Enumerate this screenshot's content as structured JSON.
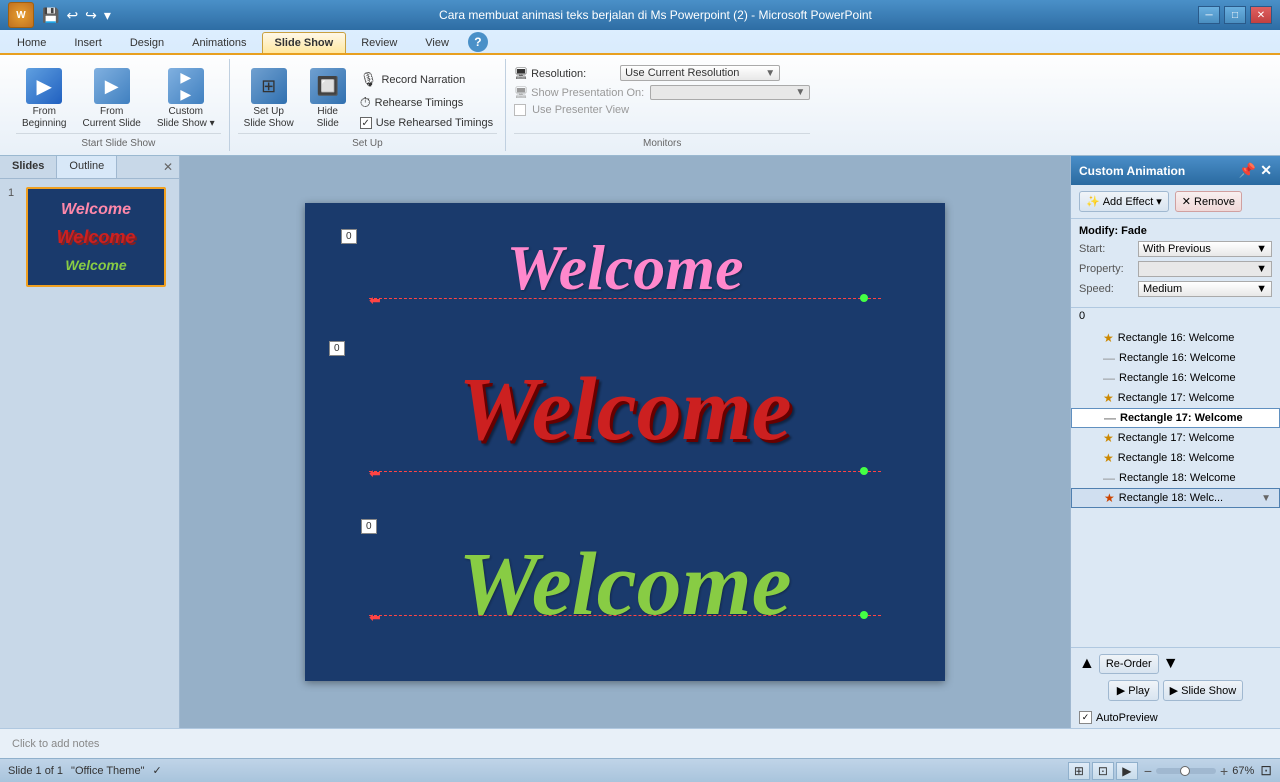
{
  "titleBar": {
    "title": "Cara membuat animasi teks berjalan di Ms Powerpoint (2) - Microsoft PowerPoint",
    "buttons": [
      "minimize",
      "maximize",
      "close"
    ]
  },
  "ribbon": {
    "tabs": [
      "Home",
      "Insert",
      "Design",
      "Animations",
      "Slide Show",
      "Review",
      "View"
    ],
    "activeTab": "Slide Show",
    "groups": {
      "startSlideShow": {
        "label": "Start Slide Show",
        "buttons": [
          {
            "id": "from-beginning",
            "label": "From\nBeginning",
            "icon": "▶"
          },
          {
            "id": "from-current",
            "label": "From\nCurrent Slide",
            "icon": "▶"
          },
          {
            "id": "custom-slide-show",
            "label": "Custom\nSlide Show",
            "icon": "▶"
          },
          {
            "id": "slide-show-label",
            "label": "Slide Show",
            "icon": ""
          }
        ]
      },
      "setUp": {
        "label": "Set Up",
        "buttons": [
          {
            "id": "set-up-slide-show",
            "label": "Set Up\nSlide Show",
            "icon": "⚙"
          },
          {
            "id": "hide-slide",
            "label": "Hide\nSlide",
            "icon": "🔲"
          }
        ],
        "smallButtons": [
          {
            "id": "record-narration",
            "label": "Record Narration",
            "icon": "🎙"
          },
          {
            "id": "rehearse-timings",
            "label": "Rehearse Timings",
            "icon": "⏱"
          },
          {
            "id": "use-rehearsed-timings",
            "label": "Use Rehearsed Timings",
            "icon": "✓",
            "checkbox": true
          }
        ]
      },
      "monitors": {
        "label": "Monitors",
        "rows": [
          {
            "label": "Resolution:",
            "value": "Use Current Resolution",
            "icon": "▼"
          },
          {
            "label": "Show Presentation On:",
            "value": "",
            "icon": "▼"
          },
          {
            "label": "Use Presenter View",
            "checkbox": true
          }
        ]
      }
    }
  },
  "slidesPanel": {
    "tabs": [
      "Slides",
      "Outline"
    ],
    "activeTab": "Slides",
    "slides": [
      {
        "number": 1,
        "texts": [
          {
            "text": "Welcome",
            "color": "pink"
          },
          {
            "text": "Welcome",
            "color": "red"
          },
          {
            "text": "Welcome",
            "color": "green"
          }
        ]
      }
    ]
  },
  "canvas": {
    "badge1": "0",
    "badge2": "0",
    "badge3": "0",
    "welcome1": "Welcome",
    "welcome2": "Welcome",
    "welcome3": "Welcome"
  },
  "animationPanel": {
    "title": "Custom Animation",
    "toolbar": {
      "addEffect": "Add Effect",
      "remove": "Remove"
    },
    "modify": {
      "title": "Modify: Fade",
      "start": {
        "label": "Start:",
        "value": "With Previous",
        "icon": "▼"
      },
      "property": {
        "label": "Property:",
        "value": "",
        "icon": "▼"
      },
      "speed": {
        "label": "Speed:",
        "value": "Medium",
        "icon": "▼"
      }
    },
    "listBadge": "0",
    "items": [
      {
        "id": "r16-1",
        "icon": "star",
        "text": "Rectangle 16: Welcome",
        "selected": false,
        "badge": true
      },
      {
        "id": "r16-2",
        "icon": "line",
        "text": "Rectangle 16: Welcome",
        "selected": false
      },
      {
        "id": "r16-3",
        "icon": "line",
        "text": "Rectangle 16: Welcome",
        "selected": false
      },
      {
        "id": "r17-1",
        "icon": "star",
        "text": "Rectangle 17: Welcome",
        "selected": false
      },
      {
        "id": "r17-2",
        "icon": "line",
        "text": "Rectangle 17: Welcome",
        "selected": true
      },
      {
        "id": "r17-3",
        "icon": "star",
        "text": "Rectangle 17: Welcome",
        "selected": false
      },
      {
        "id": "r18-1",
        "icon": "star",
        "text": "Rectangle 18: Welcome",
        "selected": false
      },
      {
        "id": "r18-2",
        "icon": "line",
        "text": "Rectangle 18: Welcome",
        "selected": false
      },
      {
        "id": "r18-3",
        "icon": "star",
        "text": "Rectangle 18: Welc...",
        "selected": true,
        "hasDropdown": true
      }
    ],
    "footer": {
      "reorder": "Re-Order",
      "play": "Play",
      "slideShow": "Slide Show"
    },
    "autoPreview": "AutoPreview"
  },
  "statusBar": {
    "slide": "Slide 1 of 1",
    "theme": "\"Office Theme\"",
    "zoom": "67%"
  },
  "notes": {
    "placeholder": "Click to add notes"
  }
}
